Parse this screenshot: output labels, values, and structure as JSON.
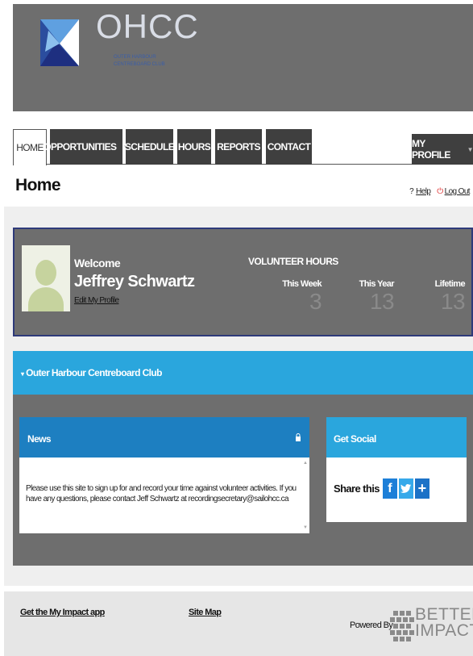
{
  "header": {
    "logo_title": "OHCC",
    "logo_subtitle_line1": "OUTER HARBOUR",
    "logo_subtitle_line2": "CENTREBOARD CLUB"
  },
  "nav": {
    "tabs": [
      {
        "label": "HOME",
        "active": true
      },
      {
        "label": "OPPORTUNITIES",
        "dropdown": true
      },
      {
        "label": "SCHEDULE"
      },
      {
        "label": "HOURS"
      },
      {
        "label": "REPORTS"
      },
      {
        "label": "CONTACT"
      }
    ],
    "profile_label": "MY PROFILE"
  },
  "page": {
    "title": "Home",
    "help_prefix": "?",
    "help_label": "Help",
    "logout_label": "Log Out"
  },
  "welcome": {
    "greeting": "Welcome",
    "name": "Jeffrey Schwartz",
    "edit_profile": "Edit My Profile",
    "hours_title": "VOLUNTEER HOURS",
    "hours": [
      {
        "label": "This Week",
        "value": "3"
      },
      {
        "label": "This Year",
        "value": "13"
      },
      {
        "label": "Lifetime",
        "value": "13"
      }
    ]
  },
  "org": {
    "title": "Outer Harbour Centreboard Club",
    "caret": "▾"
  },
  "news": {
    "title": "News",
    "text": "Please use this site to sign up for and record your time against volunteer activities.  If you have any questions, please contact Jeff Schwartz at recordingsecretary@sailohcc.ca"
  },
  "social": {
    "title": "Get Social",
    "share_label": "Share this",
    "facebook": "f",
    "plus": "+"
  },
  "footer": {
    "app_link": "Get the My Impact app",
    "sitemap_link": "Site Map",
    "powered_by": "Powered By",
    "brand_line1": "BETTER",
    "brand_line2": "IMPACT"
  },
  "colors": {
    "header_grey": "#6e6e6e",
    "nav_dark": "#3f3f3f",
    "accent_blue": "#2aa6dd",
    "news_blue": "#1d7fc1",
    "welcome_border": "#2e3a7a"
  }
}
